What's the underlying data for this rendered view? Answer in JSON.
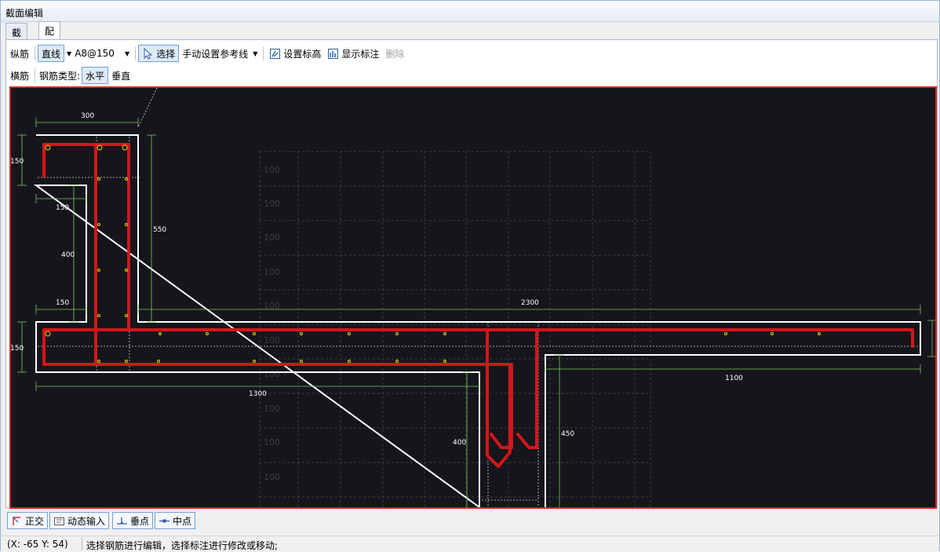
{
  "window": {
    "title": "截面编辑"
  },
  "tabs": [
    {
      "label": "截面"
    },
    {
      "label": "配筋"
    }
  ],
  "toolbar1": {
    "longitudinal": "纵筋",
    "line_mode": "直线",
    "spec_value": "A8@150",
    "select": "选择",
    "manual_ref": "手动设置参考线",
    "set_elevation": "设置标高",
    "show_dims": "显示标注",
    "delete": "删除"
  },
  "toolbar2": {
    "transverse": "横筋",
    "bar_type_label": "钢筋类型:",
    "horizontal": "水平",
    "vertical": "垂直"
  },
  "drawing": {
    "grid_label": "100",
    "dims": {
      "top_width": "300",
      "left_flange": "150",
      "upper_notch": "150",
      "stem": "400",
      "lower_notch": "150",
      "col_height": "550",
      "slab_thickness": "150",
      "slab_length": "2300",
      "left_run": "1300",
      "right_run": "1100",
      "drop_left": "400",
      "drop_right": "450"
    },
    "colors": {
      "background": "#15161b",
      "outline": "#ffffff",
      "rebar": "#d3161c",
      "dim": "#7ec860",
      "point": "#e6d414",
      "border": "#dd2222"
    }
  },
  "bottom": {
    "ortho": "正交",
    "dynamic_input": "动态输入",
    "perp_point": "垂点",
    "mid_point": "中点"
  },
  "status": {
    "coords": "(X: -65 Y: 54)",
    "message": "选择钢筋进行编辑，选择标注进行修改或移动;"
  }
}
